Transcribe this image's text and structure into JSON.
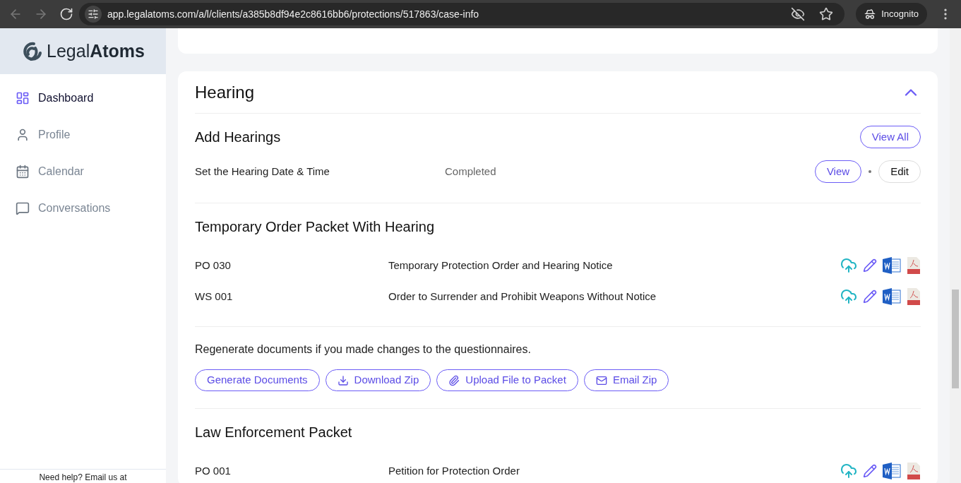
{
  "browser": {
    "url": "app.legalatoms.com/a/l/clients/a385b8df94e2c8616bb6/protections/517863/case-info",
    "profile": "Incognito"
  },
  "sidebar": {
    "logo": {
      "light": "Legal",
      "bold": "Atoms"
    },
    "items": [
      {
        "label": "Dashboard",
        "selected": true
      },
      {
        "label": "Profile",
        "selected": false
      },
      {
        "label": "Calendar",
        "selected": false
      },
      {
        "label": "Conversations",
        "selected": false
      }
    ],
    "footer": "Need help? Email us at"
  },
  "section": {
    "title": "Hearing",
    "expanded": true,
    "hearings": {
      "title": "Add Hearings",
      "view_all": "View All",
      "rows": [
        {
          "label": "Set the Hearing Date & Time",
          "status": "Completed",
          "view": "View",
          "edit": "Edit"
        }
      ]
    },
    "packets": [
      {
        "title": "Temporary Order Packet With Hearing",
        "documents": [
          {
            "code": "PO 030",
            "name": "Temporary Protection Order and Hearing Notice"
          },
          {
            "code": "WS 001",
            "name": "Order to Surrender and Prohibit Weapons Without Notice"
          }
        ],
        "note": "Regenerate documents if you made changes to the questionnaires.",
        "actions": [
          {
            "label": "Generate Documents"
          },
          {
            "label": "Download Zip"
          },
          {
            "label": "Upload File to Packet"
          },
          {
            "label": "Email Zip"
          }
        ]
      },
      {
        "title": "Law Enforcement Packet",
        "documents": [
          {
            "code": "PO 001",
            "name": "Petition for Protection Order"
          }
        ]
      }
    ]
  }
}
